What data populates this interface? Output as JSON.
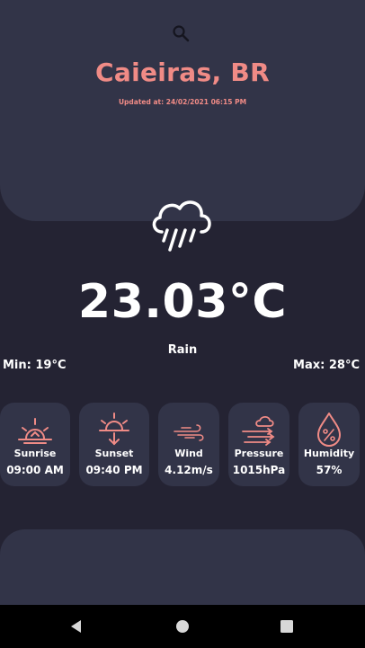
{
  "header": {
    "city": "Caieiras, BR",
    "updated": "Updated at: 24/02/2021 06:15 PM"
  },
  "current": {
    "icon": "rain-cloud-icon",
    "temperature": "23.03°C",
    "description": "Rain",
    "min": "Min: 19°C",
    "max": "Max: 28°C"
  },
  "cards": [
    {
      "label": "Sunrise",
      "value": "09:00 AM",
      "icon": "sunrise-icon"
    },
    {
      "label": "Sunset",
      "value": "09:40 PM",
      "icon": "sunset-icon"
    },
    {
      "label": "Wind",
      "value": "4.12m/s",
      "icon": "wind-icon"
    },
    {
      "label": "Pressure",
      "value": "1015hPa",
      "icon": "pressure-icon"
    },
    {
      "label": "Humidity",
      "value": "57%",
      "icon": "humidity-icon"
    }
  ],
  "colors": {
    "accent": "#f08b86",
    "background": "#242333",
    "panel": "#323448",
    "text": "#ffffff"
  }
}
